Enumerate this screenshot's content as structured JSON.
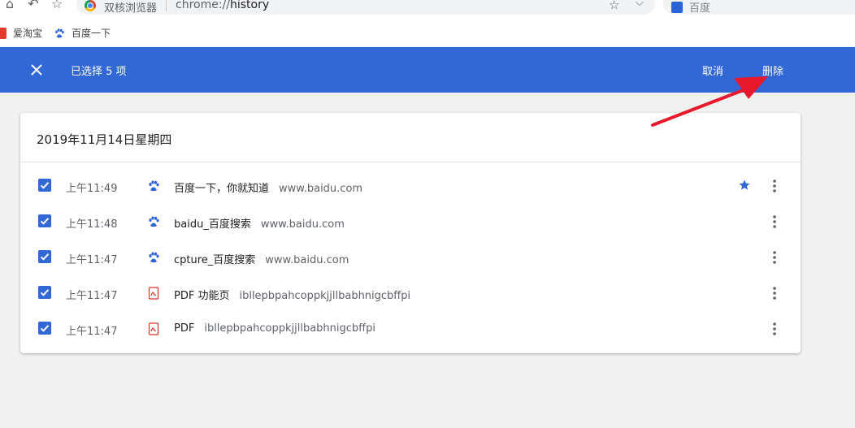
{
  "browser": {
    "name": "双核浏览器",
    "url_scheme": "chrome://",
    "url_path": "history",
    "search_placeholder": "百度"
  },
  "bookmarks": [
    {
      "label": "爱淘宝",
      "icon": "taobao-icon"
    },
    {
      "label": "百度一下",
      "icon": "baidu-paw-icon"
    }
  ],
  "selection_bar": {
    "count_label": "已选择 5 项",
    "cancel_label": "取消",
    "delete_label": "删除",
    "color": "#3267d6"
  },
  "history": {
    "date": "2019年11月14日星期四",
    "items": [
      {
        "time": "上午11:49",
        "title": "百度一下，你就知道",
        "domain": "www.baidu.com",
        "icon": "baidu-paw-icon",
        "checked": true,
        "starred": true
      },
      {
        "time": "上午11:48",
        "title": "baidu_百度搜索",
        "domain": "www.baidu.com",
        "icon": "baidu-paw-icon",
        "checked": true,
        "starred": false
      },
      {
        "time": "上午11:47",
        "title": "cpture_百度搜索",
        "domain": "www.baidu.com",
        "icon": "baidu-paw-icon",
        "checked": true,
        "starred": false
      },
      {
        "time": "上午11:47",
        "title": "PDF 功能页",
        "domain": "ibllepbpahcoppkjjllbabhnigcbffpi",
        "icon": "pdf-icon",
        "checked": true,
        "starred": false
      },
      {
        "time": "上午11:47",
        "title": "PDF",
        "domain": "ibllepbpahcoppkjjllbabhnigcbffpi",
        "icon": "pdf-icon",
        "checked": true,
        "starred": false
      }
    ]
  },
  "colors": {
    "accent": "#3267d6",
    "arrow": "#e8192c",
    "pdf": "#d93025"
  }
}
